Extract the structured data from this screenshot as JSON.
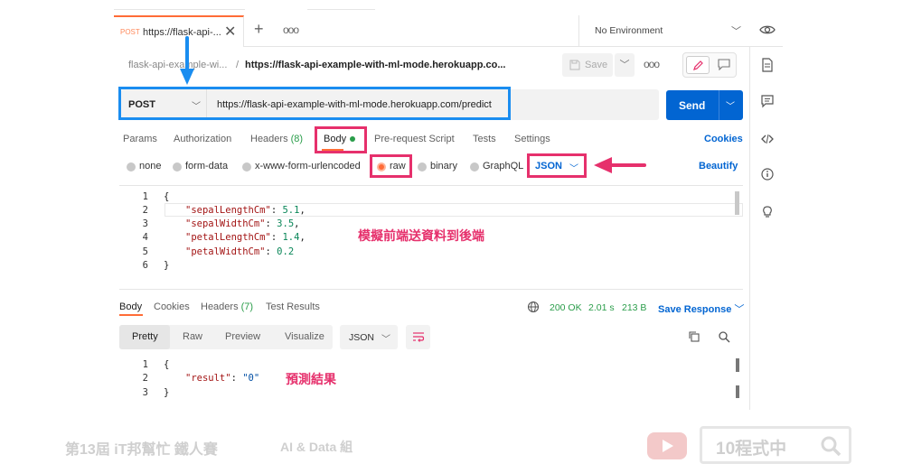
{
  "tabs": {
    "active": {
      "method": "POST",
      "title": "https://flask-api-...",
      "close": "✕"
    },
    "new_tab": "+",
    "more": "ooo"
  },
  "environment": {
    "label": "No Environment"
  },
  "breadcrumb": {
    "collection": "flask-api-example-wi...",
    "separator": "/",
    "request": "https://flask-api-example-with-ml-mode.herokuapp.co..."
  },
  "toolbar": {
    "save_label": "Save",
    "more": "ooo"
  },
  "request": {
    "method": "POST",
    "url": "https://flask-api-example-with-ml-mode.herokuapp.com/predict",
    "send_label": "Send"
  },
  "request_tabs": {
    "params": "Params",
    "authorization": "Authorization",
    "headers": "Headers",
    "headers_count": "(8)",
    "body": "Body",
    "prerequest": "Pre-request Script",
    "tests": "Tests",
    "settings": "Settings",
    "cookies": "Cookies"
  },
  "body_types": {
    "none": "none",
    "form_data": "form-data",
    "urlencoded": "x-www-form-urlencoded",
    "raw": "raw",
    "binary": "binary",
    "graphql": "GraphQL",
    "language": "JSON",
    "beautify": "Beautify"
  },
  "request_body": {
    "line_numbers": [
      "1",
      "2",
      "3",
      "4",
      "5",
      "6"
    ],
    "open": "{",
    "close": "}",
    "fields": [
      {
        "key": "\"sepalLengthCm\"",
        "value": "5.1",
        "sep": ","
      },
      {
        "key": "\"sepalWidthCm\"",
        "value": "3.5",
        "sep": ","
      },
      {
        "key": "\"petalLengthCm\"",
        "value": "1.4",
        "sep": ","
      },
      {
        "key": "\"petalWidthCm\"",
        "value": "0.2",
        "sep": ""
      }
    ]
  },
  "annotations": {
    "request": "模擬前端送資料到後端",
    "response": "預測結果"
  },
  "response_tabs": {
    "body": "Body",
    "cookies": "Cookies",
    "headers": "Headers",
    "headers_count": "(7)",
    "test_results": "Test Results"
  },
  "response_status": {
    "code": "200 OK",
    "time": "2.01 s",
    "size": "213 B",
    "save": "Save Response"
  },
  "response_view": {
    "pretty": "Pretty",
    "raw": "Raw",
    "preview": "Preview",
    "visualize": "Visualize",
    "language": "JSON"
  },
  "response_body": {
    "line_numbers": [
      "1",
      "2",
      "3"
    ],
    "open": "{",
    "close": "}",
    "key": "\"result\"",
    "value": "\"0\""
  },
  "footer": {
    "left": "第13屆 iT邦幫忙 鐵人賽",
    "middle": "AI & Data 組",
    "search_text": "10程式中"
  },
  "colors": {
    "accent_orange": "#ff6c37",
    "send_blue": "#0265d2",
    "highlight_pink": "#e6306c",
    "arrow_blue": "#1a8df0",
    "status_green": "#2a9d4a"
  }
}
